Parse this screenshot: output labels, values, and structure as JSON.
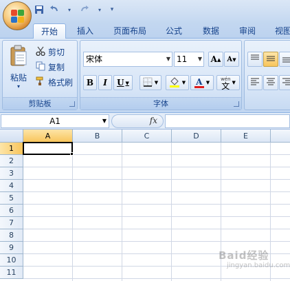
{
  "qat": {
    "save_icon": "save-icon",
    "undo_icon": "undo-icon",
    "redo_icon": "redo-icon",
    "customize_icon": "customize-qat-icon"
  },
  "tabs": [
    {
      "label": "开始",
      "active": true
    },
    {
      "label": "插入"
    },
    {
      "label": "页面布局"
    },
    {
      "label": "公式"
    },
    {
      "label": "数据"
    },
    {
      "label": "审阅"
    },
    {
      "label": "视图"
    }
  ],
  "clipboard": {
    "paste": "粘贴",
    "cut": "剪切",
    "copy": "复制",
    "format_painter": "格式刷",
    "group_label": "剪贴板"
  },
  "font": {
    "name": "宋体",
    "size": "11",
    "group_label": "字体",
    "grow_label": "A",
    "shrink_label": "A",
    "bold": "B",
    "italic": "I",
    "underline": "U",
    "font_color_label": "A",
    "phonetic_label": "文",
    "phonetic_top": "wén"
  },
  "formula_bar": {
    "name_box": "A1",
    "fx": "fx",
    "formula": ""
  },
  "columns": [
    "A",
    "B",
    "C",
    "D",
    "E"
  ],
  "rows": [
    "1",
    "2",
    "3",
    "4",
    "5",
    "6",
    "7",
    "8",
    "9",
    "10",
    "11"
  ],
  "selected_cell": "A1",
  "colors": {
    "accent": "#15428b",
    "selected_header": "#f8c55c",
    "font_color_bar": "#e01b1b",
    "fill_color_bar": "#ffff00"
  },
  "watermark": {
    "text": "Baid经验",
    "sub": "jingyan.baidu.com"
  }
}
